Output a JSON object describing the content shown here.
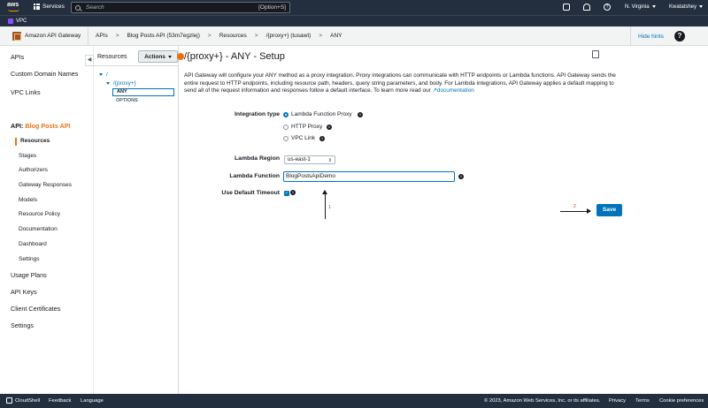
{
  "topnav": {
    "logo": "aws",
    "services": "Services",
    "search_placeholder": "Search",
    "search_shortcut": "[Option+S]",
    "region": "N. Virginia",
    "user": "Kwatatshey",
    "icons": [
      "cloudshell-icon",
      "bell-icon",
      "help-icon"
    ]
  },
  "favorites": {
    "vpc": "VPC"
  },
  "breadcrumb": {
    "service": "Amazon API Gateway",
    "items": [
      "APIs",
      "Blog Posts API (53m7egzlej)",
      "Resources",
      "/{proxy+} (tusawt)",
      "ANY"
    ],
    "separator": ">",
    "hide_hints": "Hide hints"
  },
  "leftnav": {
    "top_items": [
      "APIs",
      "Custom Domain Names",
      "VPC Links"
    ],
    "api_prefix": "API:",
    "api_name": "Blog Posts API",
    "sub_items": [
      "Resources",
      "Stages",
      "Authorizers",
      "Gateway Responses",
      "Models",
      "Resource Policy",
      "Documentation",
      "Dashboard",
      "Settings"
    ],
    "bottom_items": [
      "Usage Plans",
      "API Keys",
      "Client Certificates",
      "Settings"
    ],
    "collapse": "◀"
  },
  "resources": {
    "title": "Resources",
    "actions": "Actions",
    "tree": [
      "/",
      "/{proxy+}",
      "ANY",
      "OPTIONS"
    ]
  },
  "main": {
    "title": "/{proxy+} - ANY - Setup",
    "description": "API Gateway will configure your ANY method as a proxy integration. Proxy integrations can communicate with HTTP endpoints or Lambda functions. API Gateway sends the entire request to HTTP endpoints, including resource path, headers, query string parameters, and body. For Lambda integrations, API Gateway applies a default mapping to send all of the request information and responses follow a default interface. To learn more read our",
    "doc_link": "documentation",
    "integration_type_label": "Integration type",
    "integration_options": [
      "Lambda Function Proxy",
      "HTTP Proxy",
      "VPC Link"
    ],
    "integration_selected": "Lambda Function Proxy",
    "region_label": "Lambda Region",
    "region_value": "us-east-1",
    "function_label": "Lambda Function",
    "function_value": "BlogPostsApiDemo",
    "timeout_label": "Use Default Timeout",
    "timeout_checked": true,
    "save": "Save",
    "annotation_1": "1",
    "annotation_2": "2"
  },
  "footer": {
    "cloudshell": "CloudShell",
    "feedback": "Feedback",
    "language": "Language",
    "copyright": "© 2023, Amazon Web Services, Inc. or its affiliates.",
    "privacy": "Privacy",
    "terms": "Terms",
    "cookies": "Cookie preferences"
  },
  "colors": {
    "accent": "#ec7211",
    "link": "#0073bb",
    "nav_bg": "#232f3e"
  }
}
